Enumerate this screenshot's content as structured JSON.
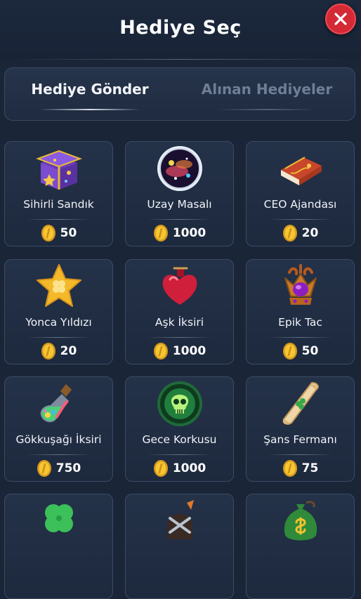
{
  "header": {
    "title": "Hediye Seç",
    "close_icon": "close-icon"
  },
  "tabs": [
    {
      "label": "Hediye Gönder",
      "active": true
    },
    {
      "label": "Alınan Hediyeler",
      "active": false
    }
  ],
  "gifts": [
    {
      "name": "Sihirli Sandık",
      "price": "50",
      "icon": "magic-chest-icon"
    },
    {
      "name": "Uzay Masalı",
      "price": "1000",
      "icon": "space-orb-icon"
    },
    {
      "name": "CEO Ajandası",
      "price": "20",
      "icon": "agenda-book-icon"
    },
    {
      "name": "Yonca Yıldızı",
      "price": "20",
      "icon": "clover-star-icon"
    },
    {
      "name": "Aşk İksiri",
      "price": "1000",
      "icon": "love-potion-icon"
    },
    {
      "name": "Epik Tac",
      "price": "50",
      "icon": "epic-crown-icon"
    },
    {
      "name": "Gökkuşağı İksiri",
      "price": "750",
      "icon": "rainbow-potion-icon"
    },
    {
      "name": "Gece Korkusu",
      "price": "1000",
      "icon": "skull-orb-icon"
    },
    {
      "name": "Şans Fermanı",
      "price": "75",
      "icon": "luck-scroll-icon"
    },
    {
      "name": "",
      "price": "",
      "icon": "four-leaf-clover-icon"
    },
    {
      "name": "",
      "price": "",
      "icon": "dark-helmet-icon"
    },
    {
      "name": "",
      "price": "",
      "icon": "money-bag-icon"
    }
  ],
  "colors": {
    "background": "#1a2538",
    "card": "#22304a",
    "accent_close": "#d42a36",
    "coin": "#f2c230"
  }
}
